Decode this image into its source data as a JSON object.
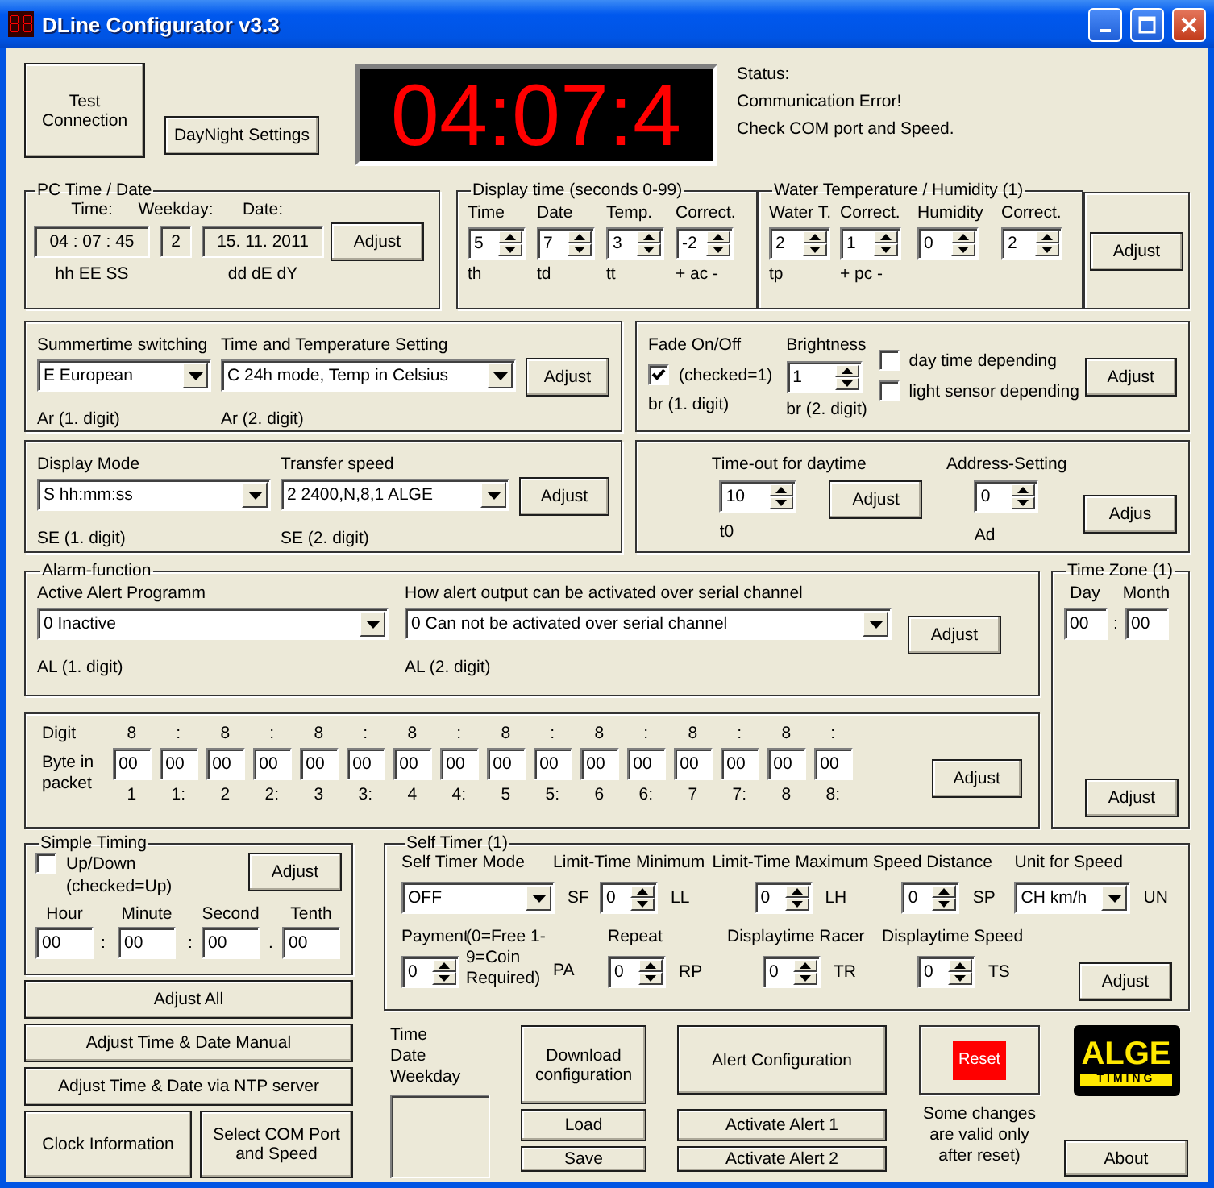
{
  "window": {
    "title": "DLine Configurator v3.3"
  },
  "top": {
    "test_button": "Test Connection",
    "daynight_button": "DayNight Settings",
    "display": "04:07:4",
    "status": [
      "Status:",
      "Communication Error!",
      "Check COM port and Speed."
    ]
  },
  "pc_time": {
    "title": "PC Time / Date",
    "labels": [
      "Time:",
      "Weekday:",
      "Date:"
    ],
    "time": "04 : 07 : 45",
    "weekday": "2",
    "date": "15. 11. 2011",
    "button": "Adjust",
    "codes": [
      "hh  EE  SS",
      "dd  dE  dY"
    ]
  },
  "display_time": {
    "title": "Display time (seconds 0-99)",
    "fields": [
      {
        "label": "Time",
        "value": "5",
        "code": "th"
      },
      {
        "label": "Date",
        "value": "7",
        "code": "td"
      },
      {
        "label": "Temp.",
        "value": "3",
        "code": "tt"
      },
      {
        "label": "Correct.",
        "value": "-2",
        "code": "+ ac -"
      }
    ]
  },
  "water": {
    "title": "Water Temperature / Humidity (1)",
    "fields": [
      {
        "label": "Water T.",
        "value": "2",
        "code": "tp"
      },
      {
        "label": "Correct.",
        "value": "1",
        "code": "+ pc -"
      },
      {
        "label": "Humidity",
        "value": "0"
      },
      {
        "label": "Correct.",
        "value": "2"
      }
    ],
    "button": "Adjust"
  },
  "summertime": {
    "combos": [
      {
        "label": "Summertime switching",
        "value": "E  European",
        "code": "Ar  (1. digit)"
      },
      {
        "label": "Time and Temperature Setting",
        "value": "C  24h mode, Temp in Celsius",
        "code": "Ar  (2. digit)"
      }
    ],
    "button": "Adjust"
  },
  "fade": {
    "fade_label": "Fade On/Off",
    "fade_checked": true,
    "fade_check_label": "(checked=1)",
    "fade_code": "br  (1. digit)",
    "brightness_label": "Brightness",
    "brightness": "1",
    "brightness_code": "br  (2. digit)",
    "options": [
      {
        "label": "day time depending",
        "checked": false
      },
      {
        "label": "light sensor depending",
        "checked": false
      }
    ],
    "button": "Adjust"
  },
  "display_mode": {
    "combos": [
      {
        "label": "Display Mode",
        "value": "S  hh:mm:ss",
        "code": "SE  (1. digit)"
      },
      {
        "label": "Transfer speed",
        "value": "2  2400,N,8,1 ALGE",
        "code": "SE  (2. digit)"
      }
    ],
    "button": "Adjust"
  },
  "timeout": {
    "fields": [
      {
        "label": "Time-out for daytime",
        "value": "10",
        "code": "t0",
        "button": "Adjust"
      },
      {
        "label": "Address-Setting",
        "value": "0",
        "code": "Ad",
        "button": "Adjus"
      }
    ]
  },
  "alarm": {
    "title": "Alarm-function",
    "combos": [
      {
        "label": "Active Alert Programm",
        "value": "0  Inactive",
        "code": "AL  (1. digit)"
      },
      {
        "label": "How alert output can be activated over serial channel",
        "value": "0  Can not be activated over serial channel",
        "code": "AL  (2. digit)"
      }
    ],
    "button": "Adjust"
  },
  "digits": {
    "digit_label": "Digit",
    "byte_label": "Byte in packet",
    "columns": [
      {
        "digit": "8",
        "value": "00",
        "index": "1"
      },
      {
        "digit": ":",
        "value": "00",
        "index": "1:"
      },
      {
        "digit": "8",
        "value": "00",
        "index": "2"
      },
      {
        "digit": ":",
        "value": "00",
        "index": "2:"
      },
      {
        "digit": "8",
        "value": "00",
        "index": "3"
      },
      {
        "digit": ":",
        "value": "00",
        "index": "3:"
      },
      {
        "digit": "8",
        "value": "00",
        "index": "4"
      },
      {
        "digit": ":",
        "value": "00",
        "index": "4:"
      },
      {
        "digit": "8",
        "value": "00",
        "index": "5"
      },
      {
        "digit": ":",
        "value": "00",
        "index": "5:"
      },
      {
        "digit": "8",
        "value": "00",
        "index": "6"
      },
      {
        "digit": ":",
        "value": "00",
        "index": "6:"
      },
      {
        "digit": "8",
        "value": "00",
        "index": "7"
      },
      {
        "digit": ":",
        "value": "00",
        "index": "7:"
      },
      {
        "digit": "8",
        "value": "00",
        "index": "8"
      },
      {
        "digit": ":",
        "value": "00",
        "index": "8:"
      }
    ],
    "button": "Adjust"
  },
  "time_zone": {
    "title": "Time Zone (1)",
    "day_label": "Day",
    "month_label": "Month",
    "day": "00",
    "separator": ":",
    "month": "00",
    "button": "Adjust"
  },
  "simple_timing": {
    "title": "Simple Timing",
    "checkbox": {
      "label": "Up/Down (checked=Up)",
      "checked": false
    },
    "button": "Adjust",
    "fields": [
      {
        "label": "Hour",
        "value": "00",
        "separator": ":"
      },
      {
        "label": "Minute",
        "value": "00",
        "separator": ":"
      },
      {
        "label": "Second",
        "value": "00",
        "separator": "."
      },
      {
        "label": "Tenth",
        "value": "00"
      }
    ]
  },
  "self_timer": {
    "title": "Self Timer (1)",
    "rows": [
      [
        {
          "label": "Self Timer Mode",
          "kind": "combo",
          "value": "OFF",
          "code": "SF"
        },
        {
          "label": "Limit-Time Minimum",
          "kind": "spin",
          "value": "0",
          "code": "LL"
        },
        {
          "label": "Limit-Time Maximum",
          "kind": "spin",
          "value": "0",
          "code": "LH"
        },
        {
          "label": "Speed Distance",
          "kind": "spin",
          "value": "0",
          "code": "SP"
        },
        {
          "label": "Unit for Speed",
          "kind": "combo",
          "value": "CH km/h",
          "code": "UN"
        }
      ],
      [
        {
          "label": "Payment",
          "kind": "spin",
          "value": "0",
          "note": "(0=Free 1-9=Coin Required)",
          "code": "PA"
        },
        {
          "label": "Repeat",
          "kind": "spin",
          "value": "0",
          "code": "RP"
        },
        {
          "label": "Displaytime Racer",
          "kind": "spin",
          "value": "0",
          "code": "TR"
        },
        {
          "label": "Displaytime Speed",
          "kind": "spin",
          "value": "0",
          "code": "TS"
        }
      ]
    ],
    "button": "Adjust"
  },
  "left_buttons": [
    "Adjust All",
    "Adjust Time & Date Manual",
    "Adjust Time & Date via NTP server"
  ],
  "corner_buttons": [
    "Clock Information",
    "Select COM Port and Speed"
  ],
  "bottom": {
    "time_lines": [
      "Time",
      "Date",
      "Weekday"
    ],
    "download": "Download configuration",
    "load": "Load",
    "save": "Save",
    "alert_config": "Alert Configuration",
    "activate": [
      "Activate Alert 1",
      "Activate Alert 2"
    ],
    "reset": "Reset",
    "note": "Some changes are valid only after reset)",
    "logo": "ALGE",
    "logo_sub": "TIMING",
    "about": "About"
  }
}
